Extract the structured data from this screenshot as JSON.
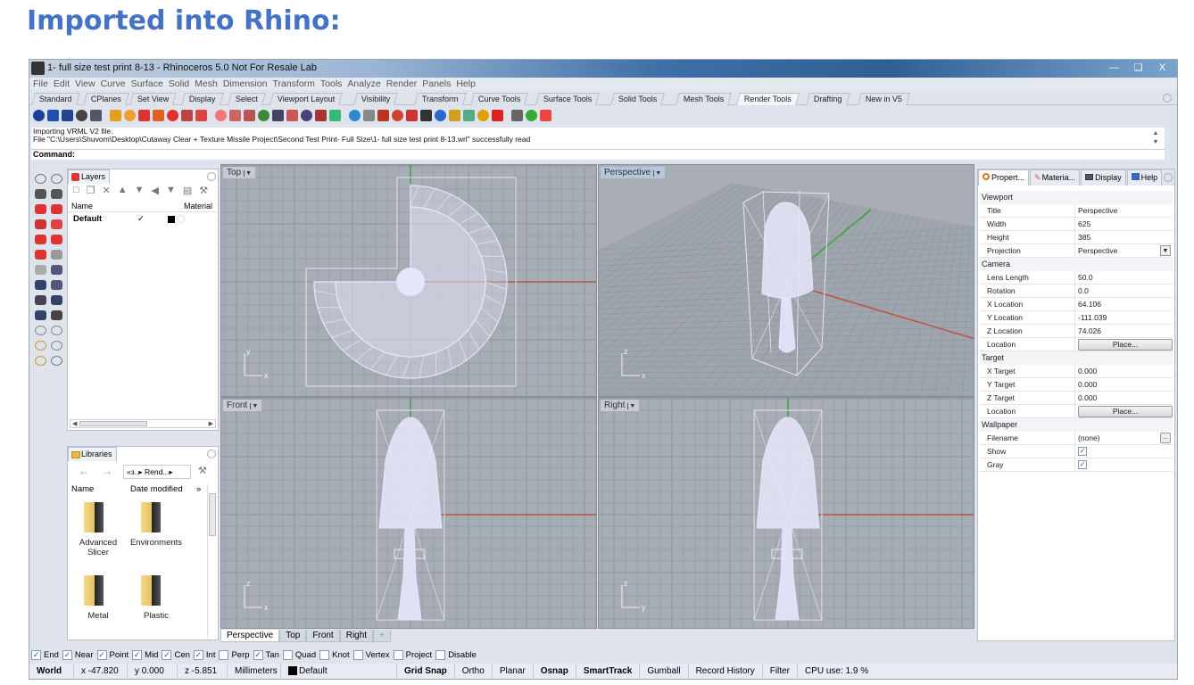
{
  "heading": "Imported into Rhino:",
  "window": {
    "title": "1- full size test print 8-13 - Rhinoceros 5.0 Not For Resale Lab",
    "buttons": [
      "minimize",
      "restore",
      "close"
    ]
  },
  "menu": [
    "File",
    "Edit",
    "View",
    "Curve",
    "Surface",
    "Solid",
    "Mesh",
    "Dimension",
    "Transform",
    "Tools",
    "Analyze",
    "Render",
    "Panels",
    "Help"
  ],
  "toolbar_tabs": [
    {
      "label": "Standard"
    },
    {
      "label": "CPlanes"
    },
    {
      "label": "Set View"
    },
    {
      "label": "Display"
    },
    {
      "label": "Select"
    },
    {
      "label": "Viewport Layout"
    },
    {
      "label": "Visibility"
    },
    {
      "label": "Transform"
    },
    {
      "label": "Curve Tools"
    },
    {
      "label": "Surface Tools"
    },
    {
      "label": "Solid Tools"
    },
    {
      "label": "Mesh Tools"
    },
    {
      "label": "Render Tools",
      "active": true
    },
    {
      "label": "Drafting"
    },
    {
      "label": "New in V5"
    }
  ],
  "command": {
    "history": [
      "Importing VRML V2 file.",
      "File \"C:\\Users\\Shuvom\\Desktop\\Cutaway Clear + Texture Missile Project\\Second Test Print- Full Size\\1- full size test print 8-13.wrl\" successfully read"
    ],
    "prompt": "Command:"
  },
  "layers_panel": {
    "tab": "Layers",
    "columns": {
      "name": "Name",
      "material": "Material"
    },
    "rows": [
      {
        "name": "Default",
        "current": "✓",
        "color": "#000000"
      }
    ]
  },
  "libraries_panel": {
    "tab": "Libraries",
    "breadcrumb": "«з..▸ Rend...▸",
    "columns": {
      "name": "Name",
      "date": "Date modified"
    },
    "items": [
      {
        "label_line1": "Advanced",
        "label_line2": "Slicer"
      },
      {
        "label_line1": "Environments",
        "label_line2": ""
      },
      {
        "label_line1": "Metal",
        "label_line2": ""
      },
      {
        "label_line1": "Plastic",
        "label_line2": ""
      }
    ]
  },
  "viewports": {
    "top": "Top",
    "perspective": "Perspective",
    "front": "Front",
    "right": "Right",
    "axes": {
      "x": "x",
      "y": "y",
      "z": "z"
    }
  },
  "viewport_tabs": [
    {
      "label": "Perspective",
      "active": true
    },
    {
      "label": "Top"
    },
    {
      "label": "Front"
    },
    {
      "label": "Right"
    },
    {
      "label": "+"
    }
  ],
  "properties_panel": {
    "tabs": [
      "Propert...",
      "Materia...",
      "Display",
      "Help"
    ],
    "sections": {
      "viewport": "Viewport",
      "camera": "Camera",
      "target": "Target",
      "wallpaper": "Wallpaper"
    },
    "viewport": {
      "title": {
        "label": "Title",
        "value": "Perspective"
      },
      "width": {
        "label": "Width",
        "value": "625"
      },
      "height": {
        "label": "Height",
        "value": "385"
      },
      "projection": {
        "label": "Projection",
        "value": "Perspective"
      }
    },
    "camera": {
      "lens": {
        "label": "Lens Length",
        "value": "50.0"
      },
      "rotation": {
        "label": "Rotation",
        "value": "0.0"
      },
      "xloc": {
        "label": "X Location",
        "value": "64.106"
      },
      "yloc": {
        "label": "Y Location",
        "value": "-111.039"
      },
      "zloc": {
        "label": "Z Location",
        "value": "74.026"
      },
      "location": {
        "label": "Location",
        "button": "Place..."
      }
    },
    "target": {
      "x": {
        "label": "X Target",
        "value": "0.000"
      },
      "y": {
        "label": "Y Target",
        "value": "0.000"
      },
      "z": {
        "label": "Z Target",
        "value": "0.000"
      },
      "location": {
        "label": "Location",
        "button": "Place..."
      }
    },
    "wallpaper": {
      "filename": {
        "label": "Filename",
        "value": "(none)",
        "button": "..."
      },
      "show": {
        "label": "Show",
        "checked": true
      },
      "gray": {
        "label": "Gray",
        "checked": true
      }
    }
  },
  "osnaps": [
    {
      "label": "End",
      "checked": true
    },
    {
      "label": "Near",
      "checked": true
    },
    {
      "label": "Point",
      "checked": true
    },
    {
      "label": "Mid",
      "checked": true
    },
    {
      "label": "Cen",
      "checked": true
    },
    {
      "label": "Int",
      "checked": true
    },
    {
      "label": "Perp",
      "checked": false
    },
    {
      "label": "Tan",
      "checked": true
    },
    {
      "label": "Quad",
      "checked": false
    },
    {
      "label": "Knot",
      "checked": false
    },
    {
      "label": "Vertex",
      "checked": false
    },
    {
      "label": "Project",
      "checked": false
    },
    {
      "label": "Disable",
      "checked": false
    }
  ],
  "status_bar": {
    "cplane": "World",
    "x": "x -47.820",
    "y": "y 0.000",
    "z": "z -5.851",
    "units": "Millimeters",
    "layer": "Default",
    "grid_snap": "Grid Snap",
    "ortho": "Ortho",
    "planar": "Planar",
    "osnap": "Osnap",
    "smarttrack": "SmartTrack",
    "gumball": "Gumball",
    "record_history": "Record History",
    "filter": "Filter",
    "cpu": "CPU use: 1.9 %"
  },
  "colors": {
    "heading": "#4472c4",
    "viewport_bg": "#a7adb4",
    "wireframe": "#e4e6fa",
    "x_axis": "#b8553a",
    "y_axis": "#3aa33a"
  }
}
